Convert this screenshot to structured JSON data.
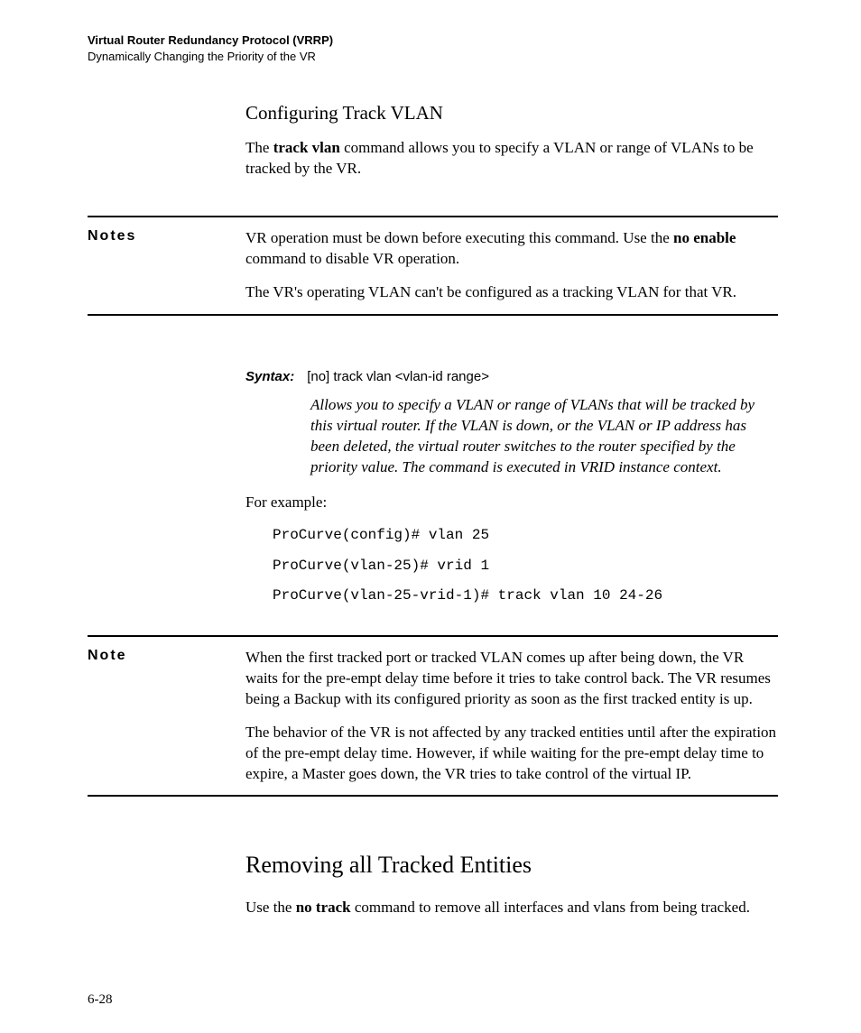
{
  "header": {
    "line1": "Virtual Router Redundancy Protocol (VRRP)",
    "line2": "Dynamically Changing the Priority of the VR"
  },
  "section1": {
    "heading": "Configuring Track VLAN",
    "intro_pre": "The ",
    "intro_bold": "track vlan",
    "intro_post": " command allows you to specify a VLAN or range of VLANs to be tracked by the VR."
  },
  "notes1": {
    "label": "Notes",
    "p1_pre": "VR operation must be down before executing this command. Use the ",
    "p1_bold": "no enable",
    "p1_post": " command to disable VR operation.",
    "p2": "The VR's operating VLAN can't be configured as a tracking VLAN for that VR."
  },
  "syntax": {
    "label": "Syntax:",
    "cmd": "[no] track vlan <vlan-id range>",
    "desc": "Allows you to specify a VLAN or range of VLANs that will be tracked by this virtual router. If the VLAN is down, or the VLAN or IP address has been deleted, the virtual router switches to the router specified by the priority value. The command is executed in VRID instance context."
  },
  "example": {
    "lead": "For example:",
    "l1": "ProCurve(config)# vlan 25",
    "l2": "ProCurve(vlan-25)# vrid 1",
    "l3": "ProCurve(vlan-25-vrid-1)# track vlan 10 24-26"
  },
  "note2": {
    "label": "Note",
    "p1": "When the first tracked port or tracked VLAN comes up after being down, the VR waits for the pre-empt delay time before it tries to take control back. The VR resumes being a Backup with its configured priority as soon as the first tracked entity is up.",
    "p2": "The behavior of the VR is not affected by any tracked entities until after the expiration of the pre-empt delay time. However, if while waiting for the pre-empt delay time to expire, a Master goes down, the VR tries to take control of the virtual IP."
  },
  "section2": {
    "heading": "Removing all Tracked Entities",
    "p_pre": "Use the ",
    "p_bold": "no track",
    "p_post": " command to remove all interfaces and vlans from being tracked."
  },
  "page_number": "6-28"
}
